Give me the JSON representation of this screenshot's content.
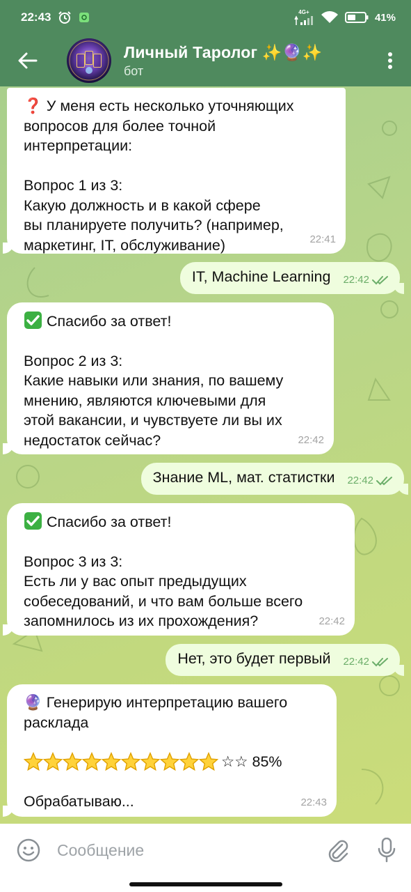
{
  "status_bar": {
    "time": "22:43",
    "network": "4G+",
    "battery": "41%"
  },
  "header": {
    "title": "Личный Таролог ✨🔮✨",
    "subtitle": "бот"
  },
  "messages": [
    {
      "direction": "in",
      "text": "❓ У меня есть несколько уточняющих\nвопросов для более точной\nинтерпретации:\n\nВопрос 1 из 3:\nКакую должность и в какой сфере\nвы планируете получить? (например,\nмаркетинг, IT, обслуживание)",
      "time": "22:41"
    },
    {
      "direction": "out",
      "text": "IT, Machine Learning",
      "time": "22:42",
      "status": "read"
    },
    {
      "direction": "in",
      "lead": "Спасибо за ответ!",
      "text": "Вопрос 2 из 3:\nКакие навыки или знания, по вашему\nмнению, являются ключевыми для\nэтой вакансии, и чувствуете ли вы их\nнедостаток сейчас?",
      "time": "22:42"
    },
    {
      "direction": "out",
      "text": "Знание ML, мат. статистки",
      "time": "22:42",
      "status": "read"
    },
    {
      "direction": "in",
      "lead": "Спасибо за ответ!",
      "text": "Вопрос 3 из 3:\nЕсть ли у вас опыт предыдущих\nсобеседований, и что вам больше всего\nзапомнилось из их прохождения?",
      "time": "22:42"
    },
    {
      "direction": "out",
      "text": "Нет, это будет первый",
      "time": "22:42",
      "status": "read"
    },
    {
      "direction": "in",
      "text": "🔮 Генерирую интерпретацию вашего\nрасклада",
      "progress": {
        "filled_stars": 10,
        "empty_stars": 2,
        "percent": 0.85,
        "label": "☆☆ 85%"
      },
      "footer": "Обрабатываю...",
      "time": "22:43"
    }
  ],
  "input": {
    "placeholder": "Сообщение"
  },
  "colors": {
    "header_bg": "#4f8a5e",
    "incoming_bubble": "#ffffff",
    "outgoing_bubble": "#effdde",
    "read_check": "#6cae6a",
    "wallpaper": "#b7d58a"
  },
  "icons": {
    "back": "arrow-left-icon",
    "menu": "more-vertical-icon",
    "emoji": "smile-icon",
    "attach": "paperclip-icon",
    "mic": "microphone-icon",
    "check": "double-check-icon"
  }
}
